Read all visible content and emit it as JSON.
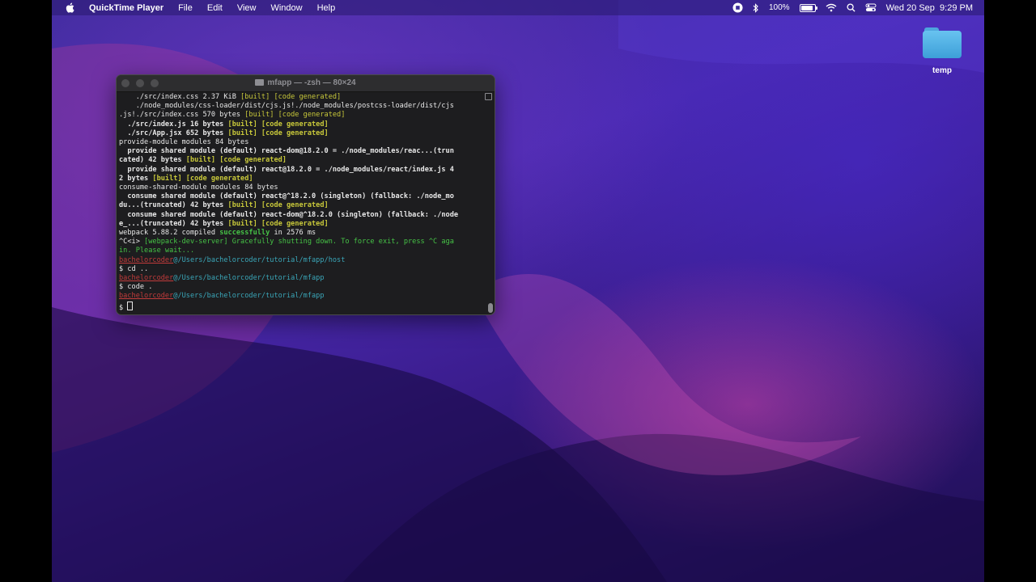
{
  "menubar": {
    "app_name": "QuickTime Player",
    "menus": [
      "File",
      "Edit",
      "View",
      "Window",
      "Help"
    ],
    "battery_percent": "100%",
    "battery_level": 1.0,
    "datetime": "Wed 20 Sep  9:29 PM"
  },
  "desktop": {
    "folder_label": "temp"
  },
  "terminal": {
    "title": "mfapp — -zsh — 80×24",
    "prompt_user": "bachelorcoder",
    "lines": {
      "l1_a": "    ./src/index.css 2.37 KiB ",
      "l1_b": "[built] [code generated]",
      "l2": "    ./node_modules/css-loader/dist/cjs.js!./node_modules/postcss-loader/dist/cjs",
      "l3_a": ".js!./src/index.css 570 bytes ",
      "l3_b": "[built] [code generated]",
      "l4_a": "  ./src/index.js 16 bytes ",
      "l4_b": "[built] [code generated]",
      "l5_a": "  ./src/App.jsx 652 bytes ",
      "l5_b": "[built] [code generated]",
      "l6": "provide-module modules 84 bytes",
      "l7": "  provide shared module (default) react-dom@18.2.0 = ./node_modules/reac...(trun",
      "l8_a": "cated) 42 bytes ",
      "l8_b": "[built] [code generated]",
      "l9": "  provide shared module (default) react@18.2.0 = ./node_modules/react/index.js 4",
      "l10_a": "2 bytes ",
      "l10_b": "[built] [code generated]",
      "l11": "consume-shared-module modules 84 bytes",
      "l12": "  consume shared module (default) react@^18.2.0 (singleton) (fallback: ./node_mo",
      "l13_a": "du...(truncated) 42 bytes ",
      "l13_b": "[built] [code generated]",
      "l14": "  consume shared module (default) react-dom@^18.2.0 (singleton) (fallback: ./node",
      "l15_a": "e_...(truncated) 42 bytes ",
      "l15_b": "[built] [code generated]",
      "l16_a": "webpack 5.88.2 compiled ",
      "l16_b": "successfully",
      "l16_c": " in 2576 ms",
      "l17_a": "^C<i> ",
      "l17_b": "[webpack-dev-server] Gracefully shutting down. To force exit, press ^C aga",
      "l18": "in. Please wait...",
      "l19_path": "@/Users/bachelorcoder/tutorial/mfapp/host",
      "l20": "$ cd ..",
      "l21_path": "@/Users/bachelorcoder/tutorial/mfapp",
      "l22": "$ code .",
      "l23_path": "@/Users/bachelorcoder/tutorial/mfapp",
      "l24": "$ "
    }
  }
}
